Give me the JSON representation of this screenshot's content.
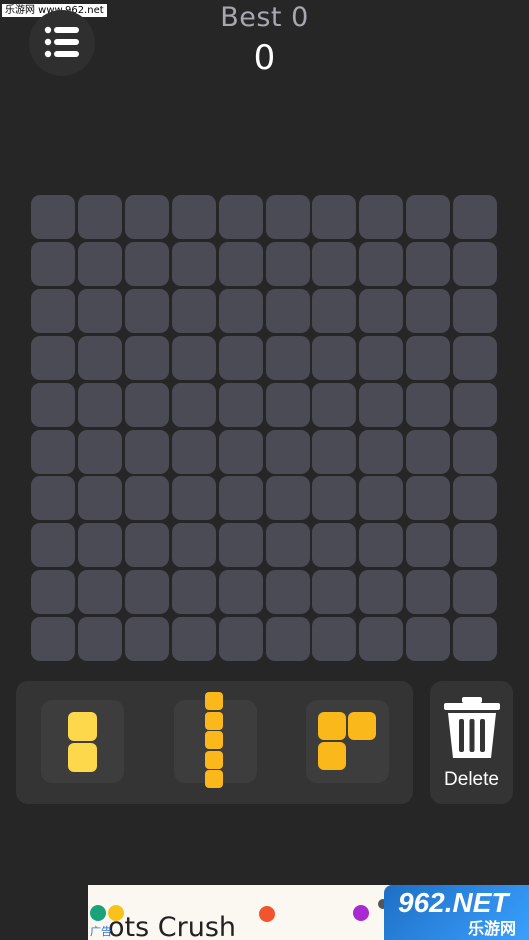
{
  "watermark_top_left": "乐游网 www.962.net",
  "header": {
    "best_label": "Best 0",
    "score": "0"
  },
  "board": {
    "rows": 10,
    "cols": 10,
    "cell_color": "#4b4b56"
  },
  "pieces": [
    {
      "name": "vertical-domino",
      "color": "#fdd84a",
      "cells": [
        [
          0,
          0
        ],
        [
          1,
          0
        ]
      ]
    },
    {
      "name": "vertical-five",
      "color": "#fbb81a",
      "cells": [
        [
          0,
          0
        ],
        [
          1,
          0
        ],
        [
          2,
          0
        ],
        [
          3,
          0
        ],
        [
          4,
          0
        ]
      ]
    },
    {
      "name": "l-tromino",
      "color": "#fbb81a",
      "cells": [
        [
          0,
          0
        ],
        [
          0,
          1
        ],
        [
          1,
          0
        ]
      ]
    }
  ],
  "delete": {
    "icon": "trash-icon",
    "label": "Delete"
  },
  "ad": {
    "tag": "广告",
    "title": "ots Crush"
  },
  "watermark_bottom_right": {
    "big": "962.NET",
    "small": "乐游网"
  },
  "colors": {
    "background": "#262626",
    "panel": "#343434",
    "yellow_light": "#fdd84a",
    "yellow": "#fbb81a"
  }
}
